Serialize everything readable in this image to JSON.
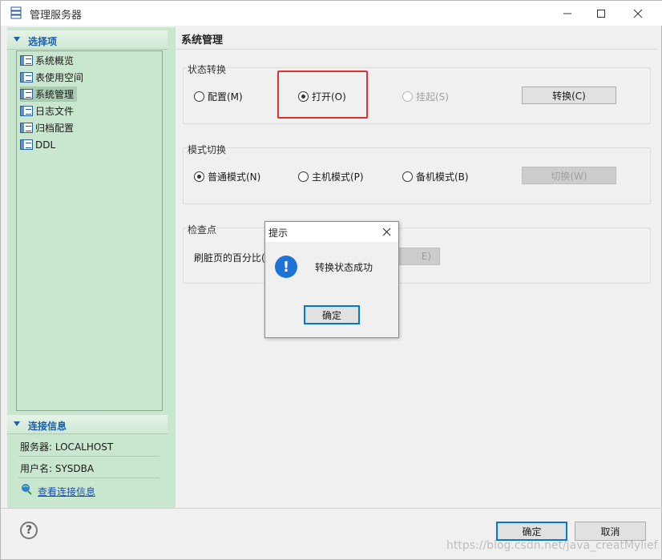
{
  "window": {
    "title": "管理服务器",
    "minimize_icon": "minimize-icon",
    "maximize_icon": "maximize-icon",
    "close_icon": "close-icon"
  },
  "sidebar": {
    "section_title": "选择项",
    "items": [
      {
        "label": "系统概览",
        "selected": false
      },
      {
        "label": "表使用空间",
        "selected": false
      },
      {
        "label": "系统管理",
        "selected": true
      },
      {
        "label": "日志文件",
        "selected": false
      },
      {
        "label": "归档配置",
        "selected": false
      },
      {
        "label": "DDL",
        "selected": false
      }
    ],
    "connection_title": "连接信息",
    "server_line": "服务器: LOCALHOST",
    "user_line": "用户名: SYSDBA",
    "view_link": "查看连接信息"
  },
  "main": {
    "title": "系统管理",
    "state_group": {
      "label": "状态转换",
      "options": [
        {
          "label": "配置(M)",
          "checked": false,
          "disabled": false
        },
        {
          "label": "打开(O)",
          "checked": true,
          "disabled": false
        },
        {
          "label": "挂起(S)",
          "checked": false,
          "disabled": true
        }
      ],
      "button": "转换(C)"
    },
    "mode_group": {
      "label": "模式切换",
      "options": [
        {
          "label": "普通模式(N)",
          "checked": true
        },
        {
          "label": "主机模式(P)",
          "checked": false
        },
        {
          "label": "备机模式(B)",
          "checked": false
        }
      ],
      "button": "切换(W)"
    },
    "checkpoint_group": {
      "label": "检查点",
      "field_label": "刷脏页的百分比(",
      "button_partial": "E)"
    }
  },
  "dialog": {
    "title": "提示",
    "message": "转换状态成功",
    "ok": "确定"
  },
  "footer": {
    "ok": "确定",
    "cancel": "取消",
    "watermark": "https://blog.csdn.net/java_creatMylief"
  },
  "colors": {
    "accent": "#1b5fa8",
    "sidebar_bg": "#c9e7ce",
    "highlight": "#e23030",
    "info": "#1e73d6"
  }
}
